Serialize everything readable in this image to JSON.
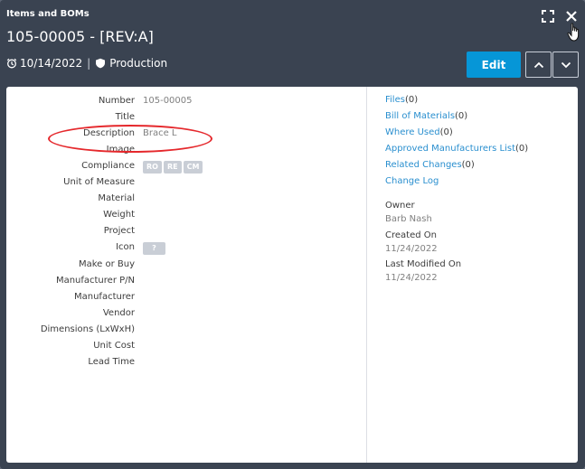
{
  "header": {
    "section_title": "Items and BOMs",
    "item_title": "105-00005 - [REV:A]",
    "date": "10/14/2022",
    "lifecycle": "Production",
    "edit_label": "Edit"
  },
  "fields": [
    {
      "label": "Number",
      "value": "105-00005"
    },
    {
      "label": "Title",
      "value": ""
    },
    {
      "label": "Description",
      "value": "Brace L"
    },
    {
      "label": "Image",
      "value": ""
    },
    {
      "label": "Compliance",
      "value": ""
    },
    {
      "label": "Unit of Measure",
      "value": ""
    },
    {
      "label": "Material",
      "value": ""
    },
    {
      "label": "Weight",
      "value": ""
    },
    {
      "label": "Project",
      "value": ""
    },
    {
      "label": "Icon",
      "value": ""
    },
    {
      "label": "Make or Buy",
      "value": ""
    },
    {
      "label": "Manufacturer P/N",
      "value": ""
    },
    {
      "label": "Manufacturer",
      "value": ""
    },
    {
      "label": "Vendor",
      "value": ""
    },
    {
      "label": "Dimensions (LxWxH)",
      "value": ""
    },
    {
      "label": "Unit Cost",
      "value": ""
    },
    {
      "label": "Lead Time",
      "value": ""
    }
  ],
  "compliance_chips": [
    "RO",
    "RE",
    "CM"
  ],
  "icon_chip": "?",
  "links": [
    {
      "label": "Files",
      "count": "(0)"
    },
    {
      "label": "Bill of Materials",
      "count": "(0)"
    },
    {
      "label": "Where Used",
      "count": "(0)"
    },
    {
      "label": "Approved Manufacturers List",
      "count": "(0)"
    },
    {
      "label": "Related Changes",
      "count": "(0)"
    },
    {
      "label": "Change Log",
      "count": ""
    }
  ],
  "info": {
    "owner_label": "Owner",
    "owner_value": "Barb Nash",
    "created_label": "Created On",
    "created_value": "11/24/2022",
    "modified_label": "Last Modified On",
    "modified_value": "11/24/2022"
  },
  "colors": {
    "header_bg": "#3a4351",
    "accent": "#0696d7",
    "link": "#2a8fcf",
    "annotation": "#e5282c"
  }
}
